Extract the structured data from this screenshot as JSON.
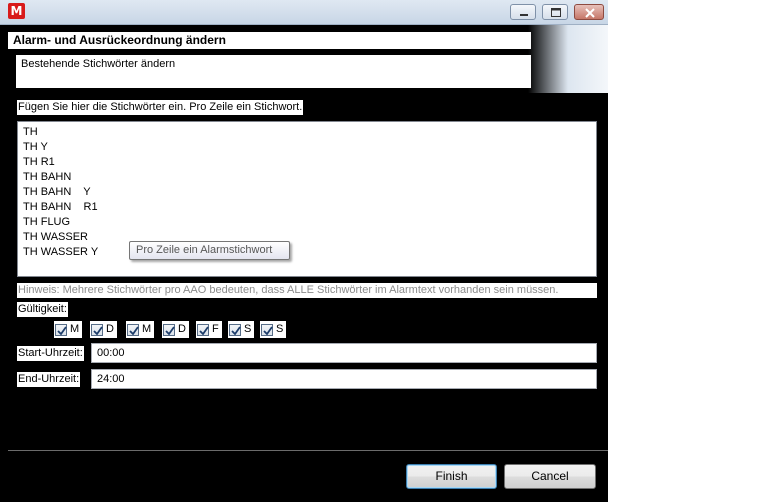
{
  "window": {
    "app_icon_letter": "M",
    "icons": {
      "app": "app-logo-icon",
      "minimize": "minimize-icon",
      "maximize": "maximize-icon",
      "close": "close-icon"
    }
  },
  "header": {
    "title": "Alarm- und Ausrückeordnung ändern",
    "subtitle": "Bestehende Stichwörter ändern"
  },
  "keywords": {
    "label": "Fügen Sie hier die Stichwörter ein. Pro Zeile ein Stichwort.",
    "lines": [
      "TH",
      "TH Y",
      "TH R1",
      "TH BAHN",
      "TH BAHN    Y",
      "TH BAHN    R1",
      "TH FLUG",
      "TH WASSER",
      "TH WASSER Y"
    ],
    "tooltip": "Pro Zeile ein Alarmstichwort"
  },
  "hint": "Hinweis: Mehrere Stichwörter pro AAO bedeuten, dass ALLE Stichwörter im Alarmtext vorhanden sein müssen.",
  "validity": {
    "label": "Gültigkeit:",
    "days": [
      {
        "label": "M",
        "checked": true
      },
      {
        "label": "D",
        "checked": true
      },
      {
        "label": "M",
        "checked": true
      },
      {
        "label": "D",
        "checked": true
      },
      {
        "label": "F",
        "checked": true
      },
      {
        "label": "S",
        "checked": true
      },
      {
        "label": "S",
        "checked": true
      }
    ]
  },
  "start_time": {
    "label": "Start-Uhrzeit:",
    "value": "00:00"
  },
  "end_time": {
    "label": "End-Uhrzeit:",
    "value": "24:00"
  },
  "buttons": {
    "finish": "Finish",
    "cancel": "Cancel"
  }
}
